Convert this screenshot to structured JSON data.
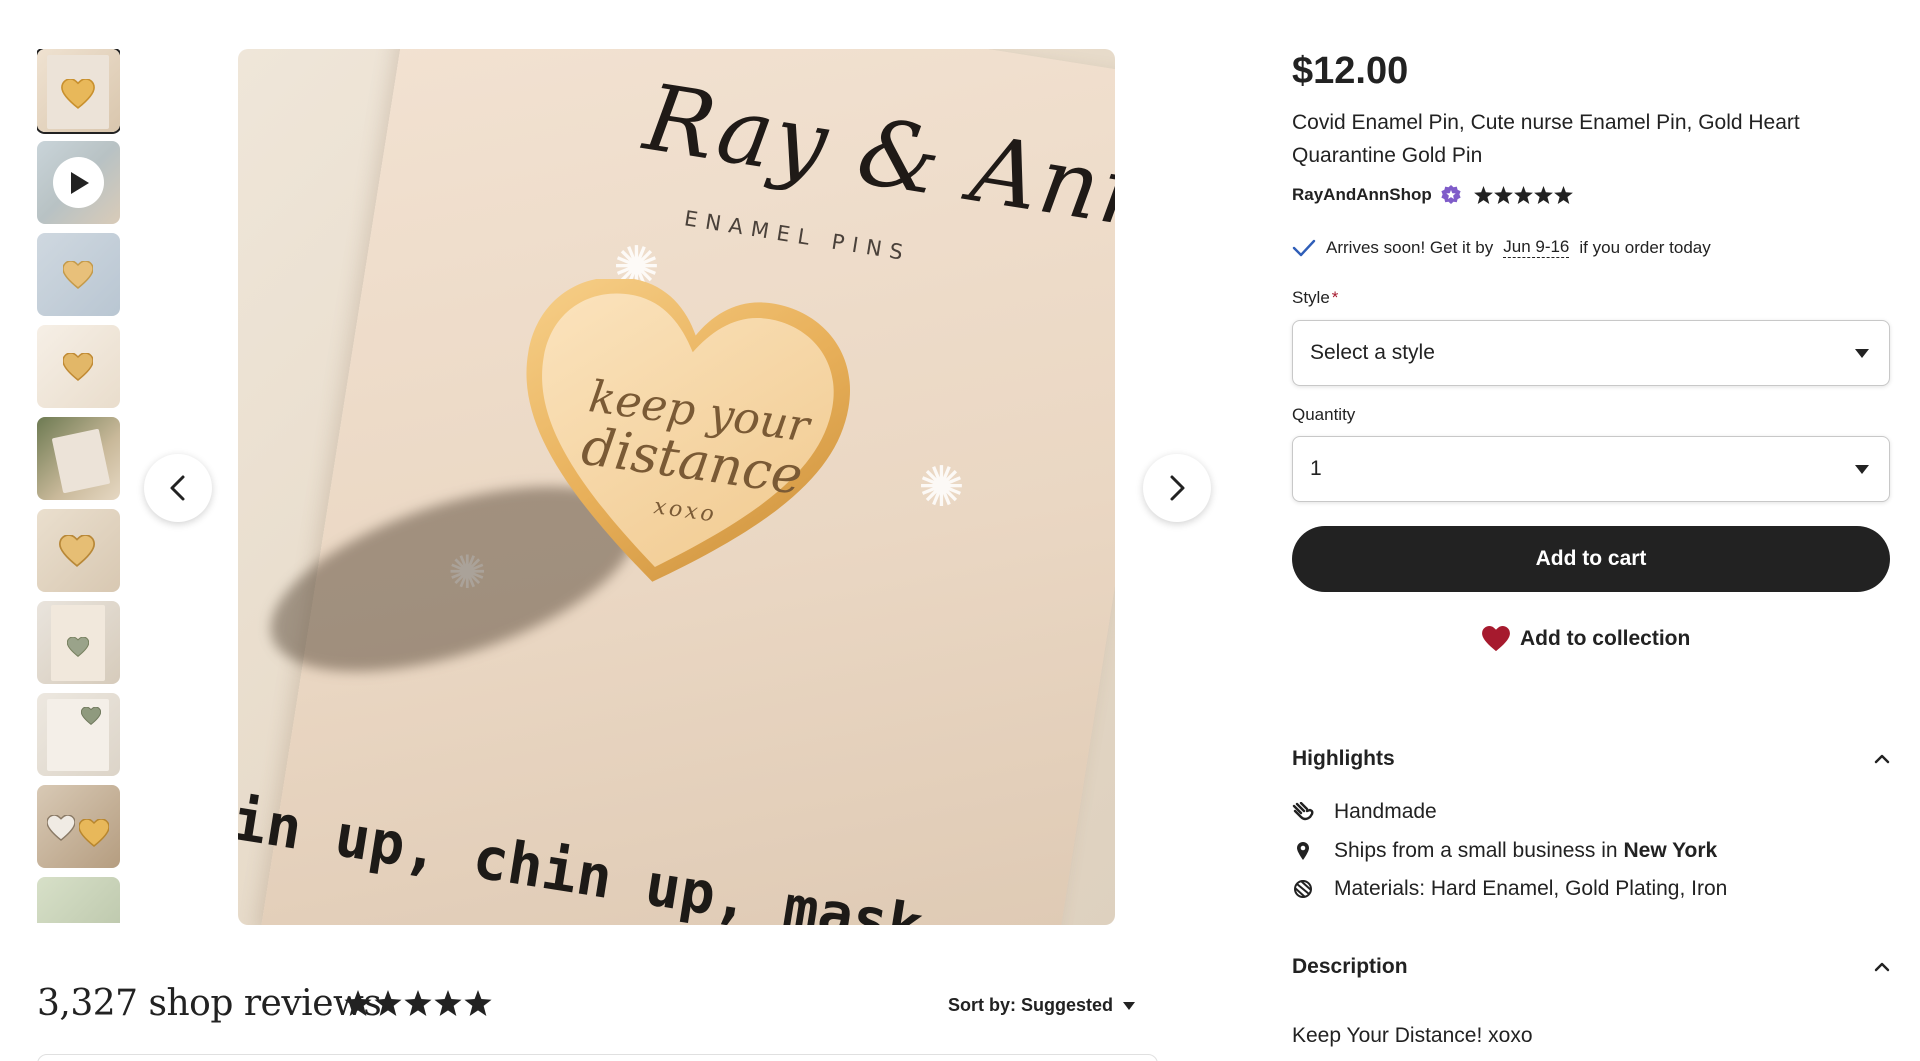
{
  "gallery": {
    "thumbnail_count": 10,
    "selected_index": 0,
    "video_thumbnail_index": 1
  },
  "main_image": {
    "brand_script": "Ray & Ann",
    "brand_sub": "ENAMEL PINS",
    "pin_line1": "keep your",
    "pin_line2": "distance",
    "pin_line3": "xoxo",
    "card_bottom_text": "in up, chin up, mask"
  },
  "reviews": {
    "title": "3,327 shop reviews",
    "rating": 5,
    "sort_label": "Sort by: Suggested"
  },
  "product": {
    "price": "$12.00",
    "title": "Covid Enamel Pin, Cute nurse Enamel Pin, Gold Heart Quarantine Gold Pin",
    "shop_name": "RayAndAnnShop",
    "shop_rating": 5,
    "arrival_prefix": "Arrives soon! Get it by",
    "arrival_dates": "Jun 9-16",
    "arrival_suffix": "if you order today"
  },
  "form": {
    "style_label": "Style",
    "required_mark": "*",
    "style_value": "Select a style",
    "quantity_label": "Quantity",
    "quantity_value": "1",
    "add_to_cart": "Add to cart",
    "add_to_collection": "Add to collection"
  },
  "highlights": {
    "heading": "Highlights",
    "handmade": "Handmade",
    "ships_prefix": "Ships from a small business in",
    "ships_location": "New York",
    "materials": "Materials: Hard Enamel, Gold Plating, Iron"
  },
  "description": {
    "heading": "Description",
    "text": "Keep Your Distance! xoxo"
  },
  "colors": {
    "text": "#222222",
    "button_bg": "#222222",
    "heart_red": "#a61a2e",
    "star_seller_purple": "#7f5cc9",
    "check_blue": "#2f5eb8",
    "gold": "#e8b85a"
  }
}
